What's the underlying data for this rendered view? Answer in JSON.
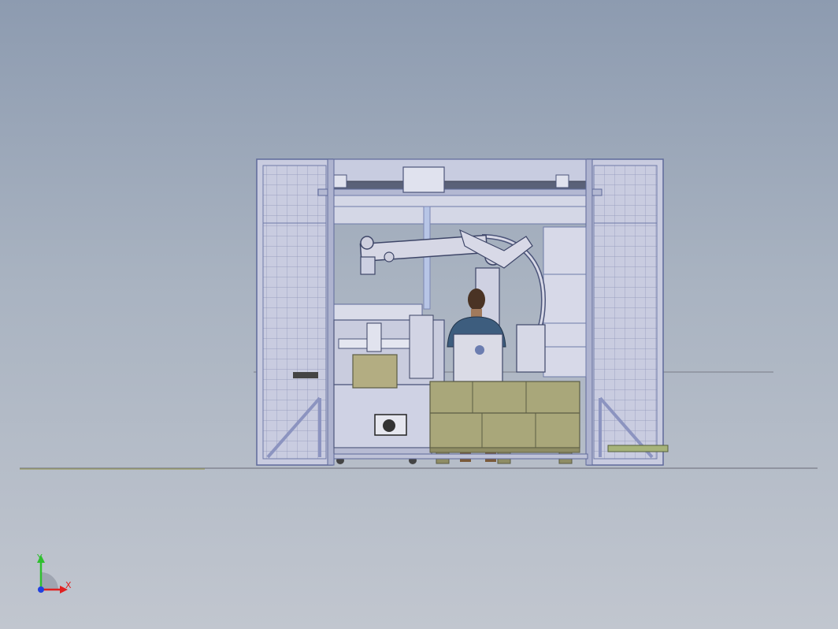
{
  "viewport": {
    "background_top": "#8d9bb0",
    "background_bottom": "#c1c6cf"
  },
  "model": {
    "frame_color": "#6e7aa8",
    "frame_fill": "#c4c8dc",
    "mesh_color": "#7d86b0",
    "box_color": "#a9a77a",
    "box_edge": "#5c5d44",
    "robot_color": "#d2d3e2",
    "operator_shirt": "#3d5d7e",
    "operator_hair": "#4a3324"
  },
  "triad": {
    "x_label": "X",
    "y_label": "Y",
    "x_color": "#e02020",
    "y_color": "#2fbf2f",
    "z_color": "#2040e0"
  }
}
